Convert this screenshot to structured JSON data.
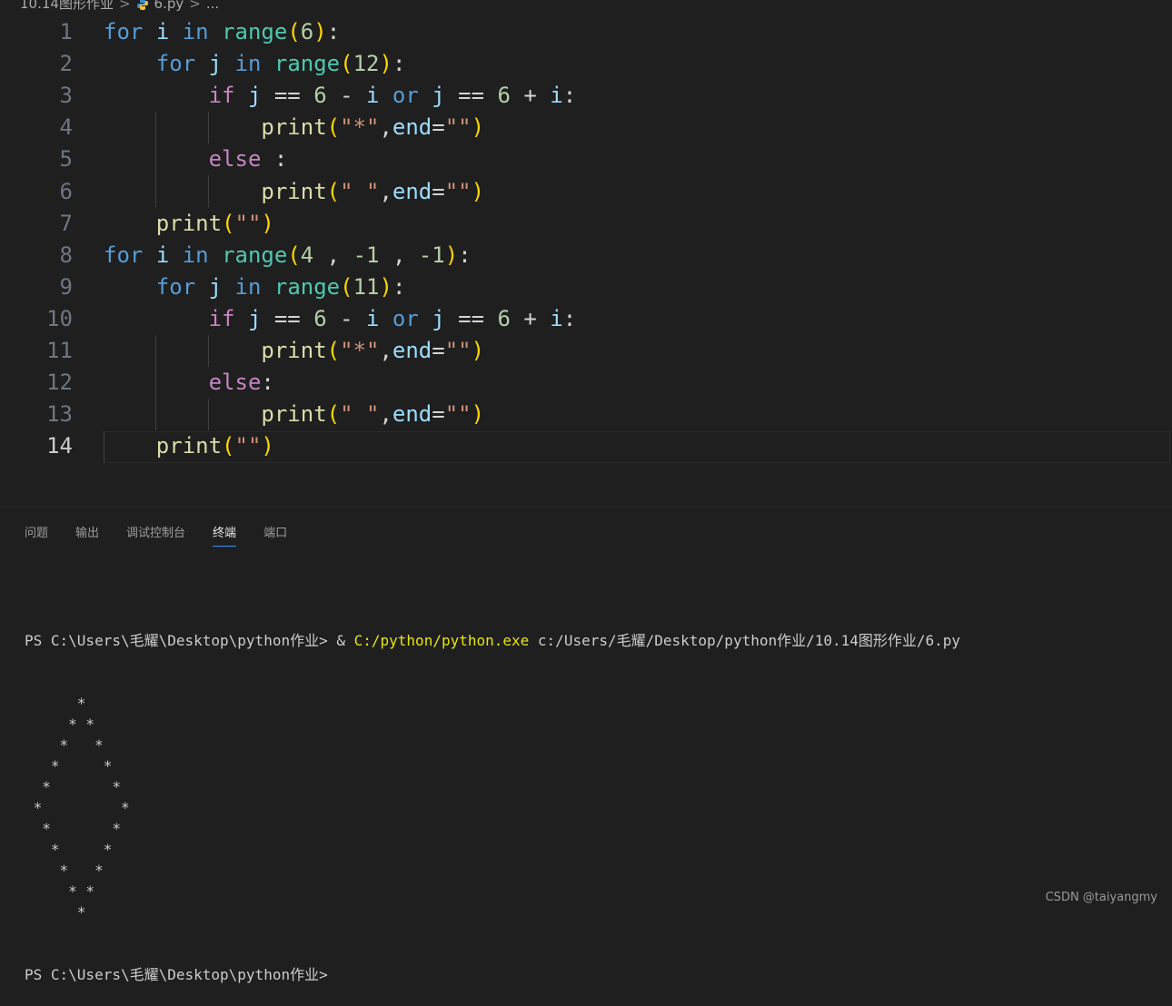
{
  "breadcrumb": {
    "folder": "10.14图形作业",
    "separator": ">",
    "file": "6.py",
    "tail": "..."
  },
  "editor": {
    "lines": [
      {
        "number": "1",
        "tokens": [
          [
            "kw",
            "for"
          ],
          [
            "op",
            " "
          ],
          [
            "var",
            "i"
          ],
          [
            "op",
            " "
          ],
          [
            "kw",
            "in"
          ],
          [
            "op",
            " "
          ],
          [
            "fn",
            "range"
          ],
          [
            "br",
            "("
          ],
          [
            "num",
            "6"
          ],
          [
            "br",
            ")"
          ],
          [
            "op",
            ":"
          ]
        ]
      },
      {
        "number": "2",
        "tokens": [
          [
            "op",
            "    "
          ],
          [
            "kw",
            "for"
          ],
          [
            "op",
            " "
          ],
          [
            "var",
            "j"
          ],
          [
            "op",
            " "
          ],
          [
            "kw",
            "in"
          ],
          [
            "op",
            " "
          ],
          [
            "fn",
            "range"
          ],
          [
            "br",
            "("
          ],
          [
            "num",
            "12"
          ],
          [
            "br",
            ")"
          ],
          [
            "op",
            ":"
          ]
        ]
      },
      {
        "number": "3",
        "tokens": [
          [
            "op",
            "        "
          ],
          [
            "ctl",
            "if"
          ],
          [
            "op",
            " "
          ],
          [
            "var",
            "j"
          ],
          [
            "op",
            " == "
          ],
          [
            "num",
            "6"
          ],
          [
            "op",
            " - "
          ],
          [
            "var",
            "i"
          ],
          [
            "op",
            " "
          ],
          [
            "kw",
            "or"
          ],
          [
            "op",
            " "
          ],
          [
            "var",
            "j"
          ],
          [
            "op",
            " == "
          ],
          [
            "num",
            "6"
          ],
          [
            "op",
            " + "
          ],
          [
            "var",
            "i"
          ],
          [
            "op",
            ":"
          ]
        ]
      },
      {
        "number": "4",
        "tokens": [
          [
            "op",
            "            "
          ],
          [
            "pr",
            "print"
          ],
          [
            "br",
            "("
          ],
          [
            "str",
            "\"*\""
          ],
          [
            "op",
            ","
          ],
          [
            "var",
            "end"
          ],
          [
            "op",
            "="
          ],
          [
            "str",
            "\"\""
          ],
          [
            "br",
            ")"
          ]
        ]
      },
      {
        "number": "5",
        "tokens": [
          [
            "op",
            "        "
          ],
          [
            "ctl",
            "else"
          ],
          [
            "op",
            " :"
          ]
        ]
      },
      {
        "number": "6",
        "tokens": [
          [
            "op",
            "            "
          ],
          [
            "pr",
            "print"
          ],
          [
            "br",
            "("
          ],
          [
            "str",
            "\" \""
          ],
          [
            "op",
            ","
          ],
          [
            "var",
            "end"
          ],
          [
            "op",
            "="
          ],
          [
            "str",
            "\"\""
          ],
          [
            "br",
            ")"
          ]
        ]
      },
      {
        "number": "7",
        "tokens": [
          [
            "op",
            "    "
          ],
          [
            "pr",
            "print"
          ],
          [
            "br",
            "("
          ],
          [
            "str",
            "\"\""
          ],
          [
            "br",
            ")"
          ]
        ]
      },
      {
        "number": "8",
        "tokens": [
          [
            "kw",
            "for"
          ],
          [
            "op",
            " "
          ],
          [
            "var",
            "i"
          ],
          [
            "op",
            " "
          ],
          [
            "kw",
            "in"
          ],
          [
            "op",
            " "
          ],
          [
            "fn",
            "range"
          ],
          [
            "br",
            "("
          ],
          [
            "num",
            "4"
          ],
          [
            "op",
            " , "
          ],
          [
            "num",
            "-1"
          ],
          [
            "op",
            " , "
          ],
          [
            "num",
            "-1"
          ],
          [
            "br",
            ")"
          ],
          [
            "op",
            ":"
          ]
        ]
      },
      {
        "number": "9",
        "tokens": [
          [
            "op",
            "    "
          ],
          [
            "kw",
            "for"
          ],
          [
            "op",
            " "
          ],
          [
            "var",
            "j"
          ],
          [
            "op",
            " "
          ],
          [
            "kw",
            "in"
          ],
          [
            "op",
            " "
          ],
          [
            "fn",
            "range"
          ],
          [
            "br",
            "("
          ],
          [
            "num",
            "11"
          ],
          [
            "br",
            ")"
          ],
          [
            "op",
            ":"
          ]
        ]
      },
      {
        "number": "10",
        "tokens": [
          [
            "op",
            "        "
          ],
          [
            "ctl",
            "if"
          ],
          [
            "op",
            " "
          ],
          [
            "var",
            "j"
          ],
          [
            "op",
            " == "
          ],
          [
            "num",
            "6"
          ],
          [
            "op",
            " - "
          ],
          [
            "var",
            "i"
          ],
          [
            "op",
            " "
          ],
          [
            "kw",
            "or"
          ],
          [
            "op",
            " "
          ],
          [
            "var",
            "j"
          ],
          [
            "op",
            " == "
          ],
          [
            "num",
            "6"
          ],
          [
            "op",
            " + "
          ],
          [
            "var",
            "i"
          ],
          [
            "op",
            ":"
          ]
        ]
      },
      {
        "number": "11",
        "tokens": [
          [
            "op",
            "            "
          ],
          [
            "pr",
            "print"
          ],
          [
            "br",
            "("
          ],
          [
            "str",
            "\"*\""
          ],
          [
            "op",
            ","
          ],
          [
            "var",
            "end"
          ],
          [
            "op",
            "="
          ],
          [
            "str",
            "\"\""
          ],
          [
            "br",
            ")"
          ]
        ]
      },
      {
        "number": "12",
        "tokens": [
          [
            "op",
            "        "
          ],
          [
            "ctl",
            "else"
          ],
          [
            "op",
            ":"
          ]
        ]
      },
      {
        "number": "13",
        "tokens": [
          [
            "op",
            "            "
          ],
          [
            "pr",
            "print"
          ],
          [
            "br",
            "("
          ],
          [
            "str",
            "\" \""
          ],
          [
            "op",
            ","
          ],
          [
            "var",
            "end"
          ],
          [
            "op",
            "="
          ],
          [
            "str",
            "\"\""
          ],
          [
            "br",
            ")"
          ]
        ]
      },
      {
        "number": "14",
        "tokens": [
          [
            "op",
            "    "
          ],
          [
            "pr",
            "print"
          ],
          [
            "br",
            "("
          ],
          [
            "str",
            "\"\""
          ],
          [
            "br",
            ")"
          ]
        ]
      }
    ]
  },
  "panel": {
    "tabs": [
      {
        "label": "问题"
      },
      {
        "label": "输出"
      },
      {
        "label": "调试控制台"
      },
      {
        "label": "终端"
      },
      {
        "label": "端口"
      }
    ]
  },
  "terminal": {
    "prompt": "PS C:\\Users\\毛耀\\Desktop\\python作业> ",
    "amp": "& ",
    "exe": "C:/python/python.exe",
    "args": " c:/Users/毛耀/Desktop/python作业/10.14图形作业/6.py",
    "output": [
      "      *",
      "     * *",
      "    *   *",
      "   *     *",
      "  *       *",
      " *         *",
      "  *       *",
      "   *     *",
      "    *   *",
      "     * *",
      "      *"
    ],
    "final_prompt": "PS C:\\Users\\毛耀\\Desktop\\python作业>"
  },
  "watermark": "CSDN @taiyangmy"
}
